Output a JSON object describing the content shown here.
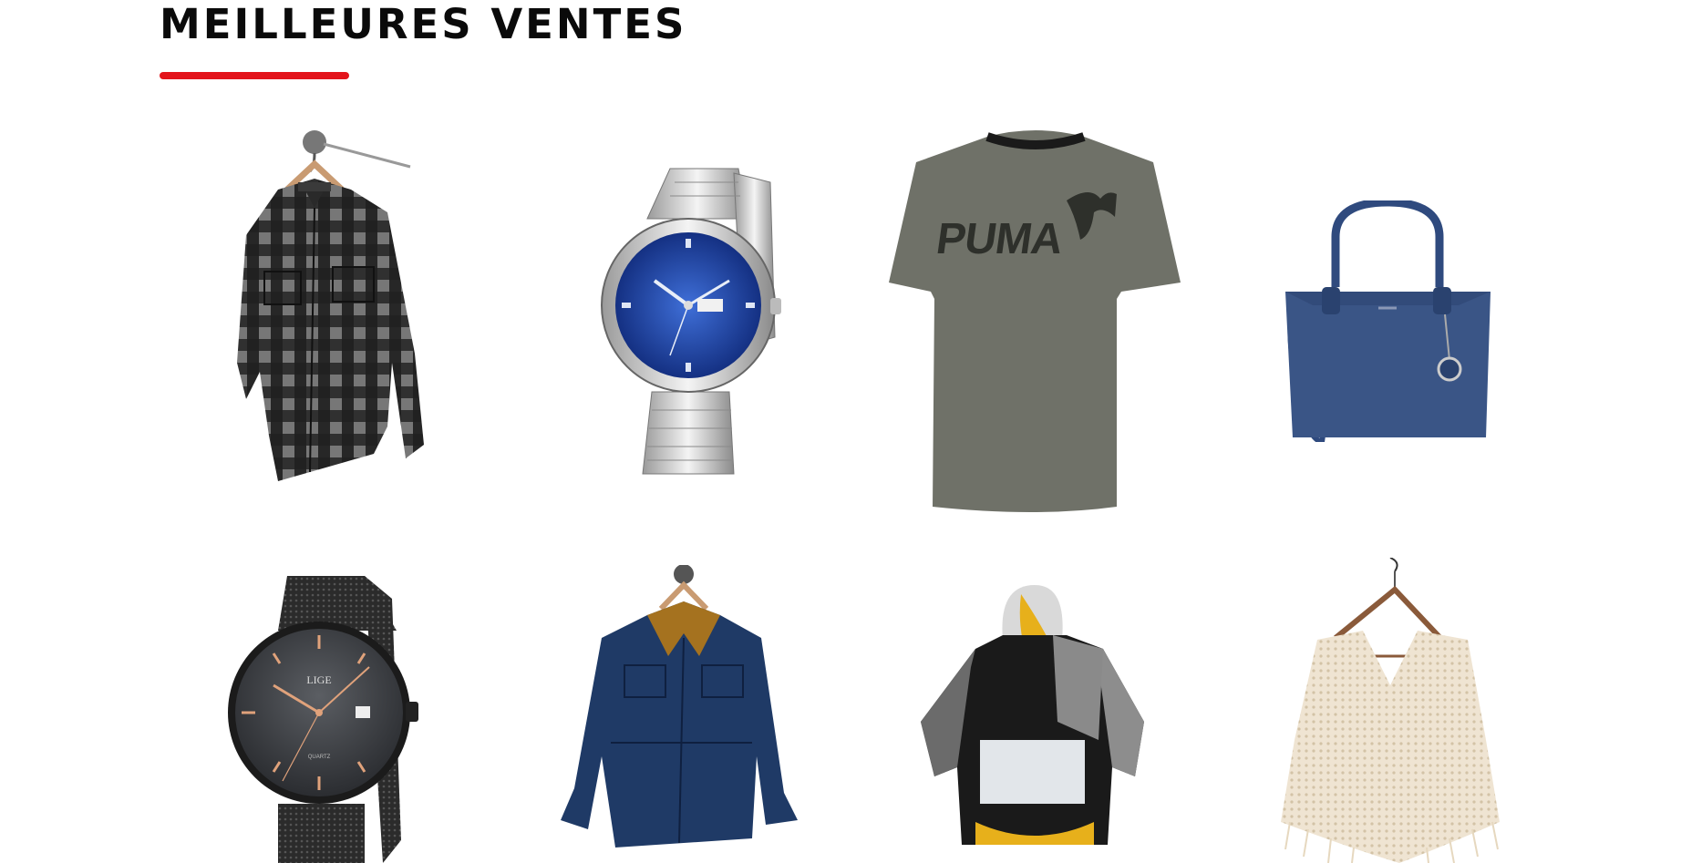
{
  "section": {
    "title": "MEILLEURES VENTES",
    "accent_color": "#e3141b"
  },
  "products": [
    {
      "icon": "plaid-shirt-icon"
    },
    {
      "icon": "blue-dial-watch-icon"
    },
    {
      "icon": "puma-tshirt-icon",
      "print": "PUMA"
    },
    {
      "icon": "blue-handbag-icon"
    },
    {
      "icon": "black-mesh-watch-icon",
      "brand": "LIGE",
      "dial_text": "QUARTZ"
    },
    {
      "icon": "denim-jacket-icon"
    },
    {
      "icon": "windbreaker-icon"
    },
    {
      "icon": "knit-poncho-icon"
    }
  ]
}
